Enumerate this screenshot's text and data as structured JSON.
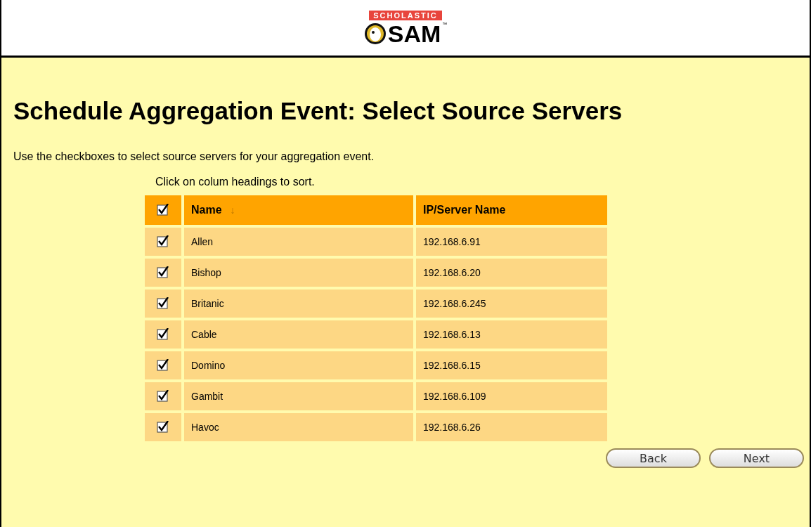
{
  "logo": {
    "brand": "SCHOLASTIC",
    "product": "SAM",
    "mark": "™"
  },
  "title": "Schedule Aggregation Event: Select Source Servers",
  "instructions": "Use the checkboxes to select source servers for your aggregation event.",
  "sort_hint": "Click on colum headings to sort.",
  "table": {
    "select_all": {
      "checked": true
    },
    "columns": [
      {
        "label": "Name",
        "sort_arrow": "↓"
      },
      {
        "label": "IP/Server Name"
      }
    ],
    "rows": [
      {
        "checked": true,
        "name": "Allen",
        "ip": "192.168.6.91"
      },
      {
        "checked": true,
        "name": "Bishop",
        "ip": "192.168.6.20"
      },
      {
        "checked": true,
        "name": "Britanic",
        "ip": "192.168.6.245"
      },
      {
        "checked": true,
        "name": "Cable",
        "ip": "192.168.6.13"
      },
      {
        "checked": true,
        "name": "Domino",
        "ip": "192.168.6.15"
      },
      {
        "checked": true,
        "name": "Gambit",
        "ip": "192.168.6.109"
      },
      {
        "checked": true,
        "name": "Havoc",
        "ip": "192.168.6.26"
      }
    ]
  },
  "buttons": [
    "Back",
    "Next"
  ]
}
